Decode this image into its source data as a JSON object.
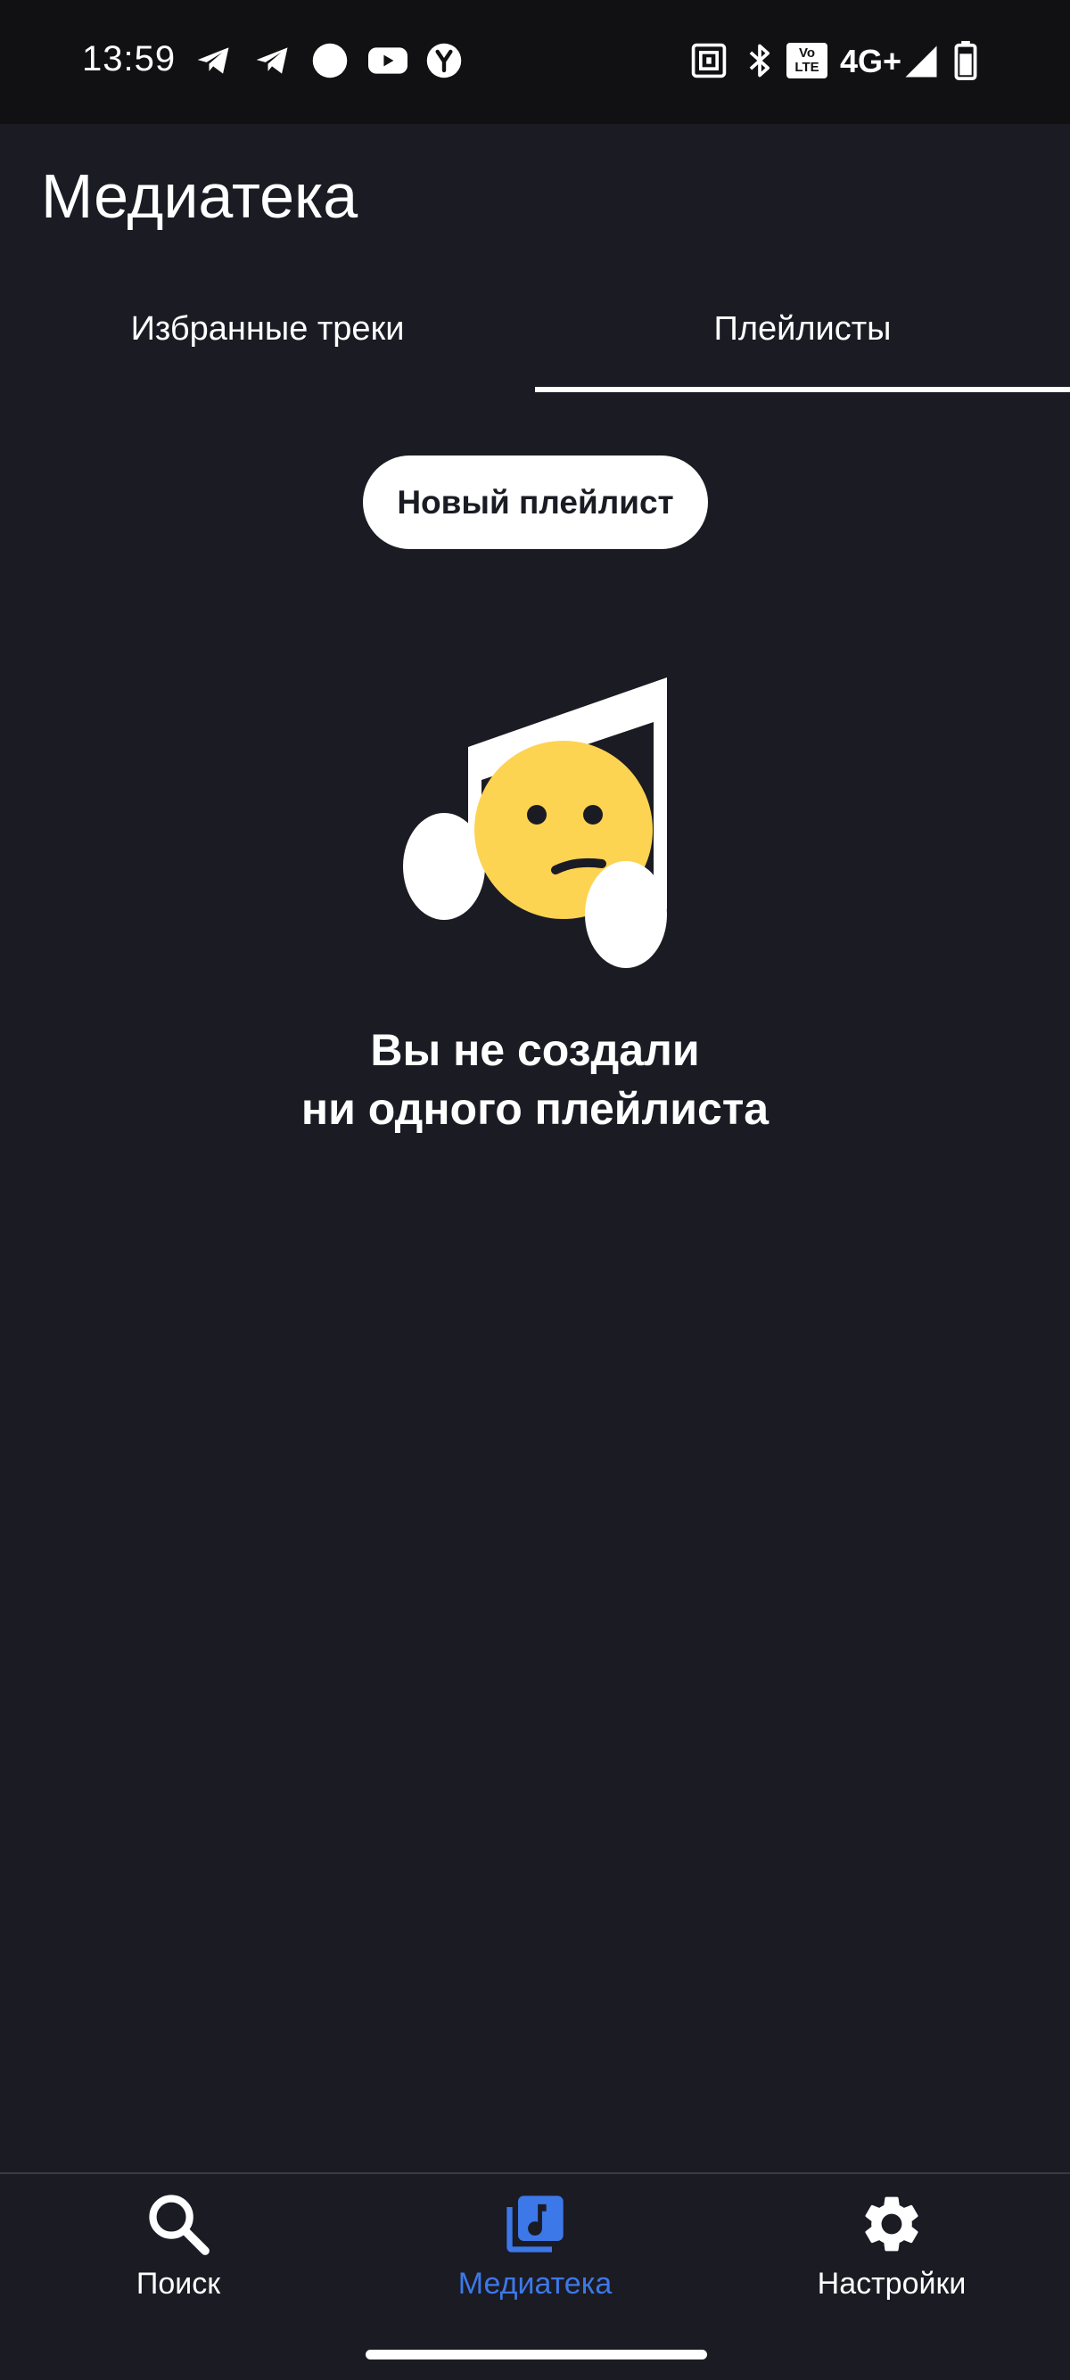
{
  "status_bar": {
    "time": "13:59",
    "network": "4G+",
    "volte_top": "Vo",
    "volte_bottom": "LTE",
    "icons": [
      "telegram-icon",
      "telegram-icon",
      "circle-icon",
      "youtube-icon",
      "yandex-icon",
      "nfc-icon",
      "bluetooth-icon",
      "volte-icon",
      "signal-icon",
      "battery-icon"
    ]
  },
  "header": {
    "title": "Медиатека"
  },
  "tabs": [
    {
      "label": "Избранные треки",
      "active": false
    },
    {
      "label": "Плейлисты",
      "active": true
    }
  ],
  "actions": {
    "new_playlist_label": "Новый плейлист"
  },
  "empty_state": {
    "line1": "Вы не создали",
    "line2": "ни одного плейлиста",
    "icon": "sad-music-note-icon"
  },
  "bottom_nav": {
    "items": [
      {
        "label": "Поиск",
        "icon": "search-icon",
        "active": false
      },
      {
        "label": "Медиатека",
        "icon": "library-music-icon",
        "active": true
      },
      {
        "label": "Настройки",
        "icon": "gear-icon",
        "active": false
      }
    ],
    "active_color": "#3d78e8"
  },
  "colors": {
    "background": "#1b1b24",
    "status_bar": "#111113",
    "emoji_face": "#fdd352",
    "text": "#ffffff"
  }
}
